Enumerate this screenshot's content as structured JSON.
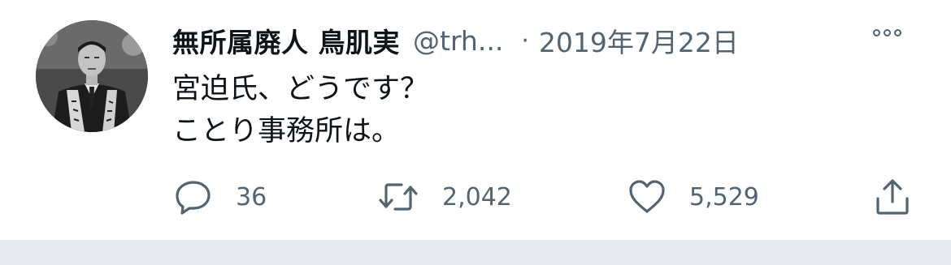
{
  "tweet": {
    "display_name": "無所属廃人 鳥肌実",
    "handle": "@trh...",
    "separator": "·",
    "date": "2019年7月22日",
    "text_lines": [
      "宮迫氏、どうです？",
      "ことり事務所は。"
    ]
  },
  "actions": {
    "reply": {
      "icon": "reply-bubble-icon",
      "count": "36"
    },
    "retweet": {
      "icon": "retweet-icon",
      "count": "2,042"
    },
    "like": {
      "icon": "heart-icon",
      "count": "5,529"
    },
    "share": {
      "icon": "share-upload-icon"
    }
  },
  "more_icon": "more-options-icon",
  "colors": {
    "primary_text": "#0f1419",
    "secondary_text": "#536471",
    "footer_background": "#e6e9ef"
  }
}
